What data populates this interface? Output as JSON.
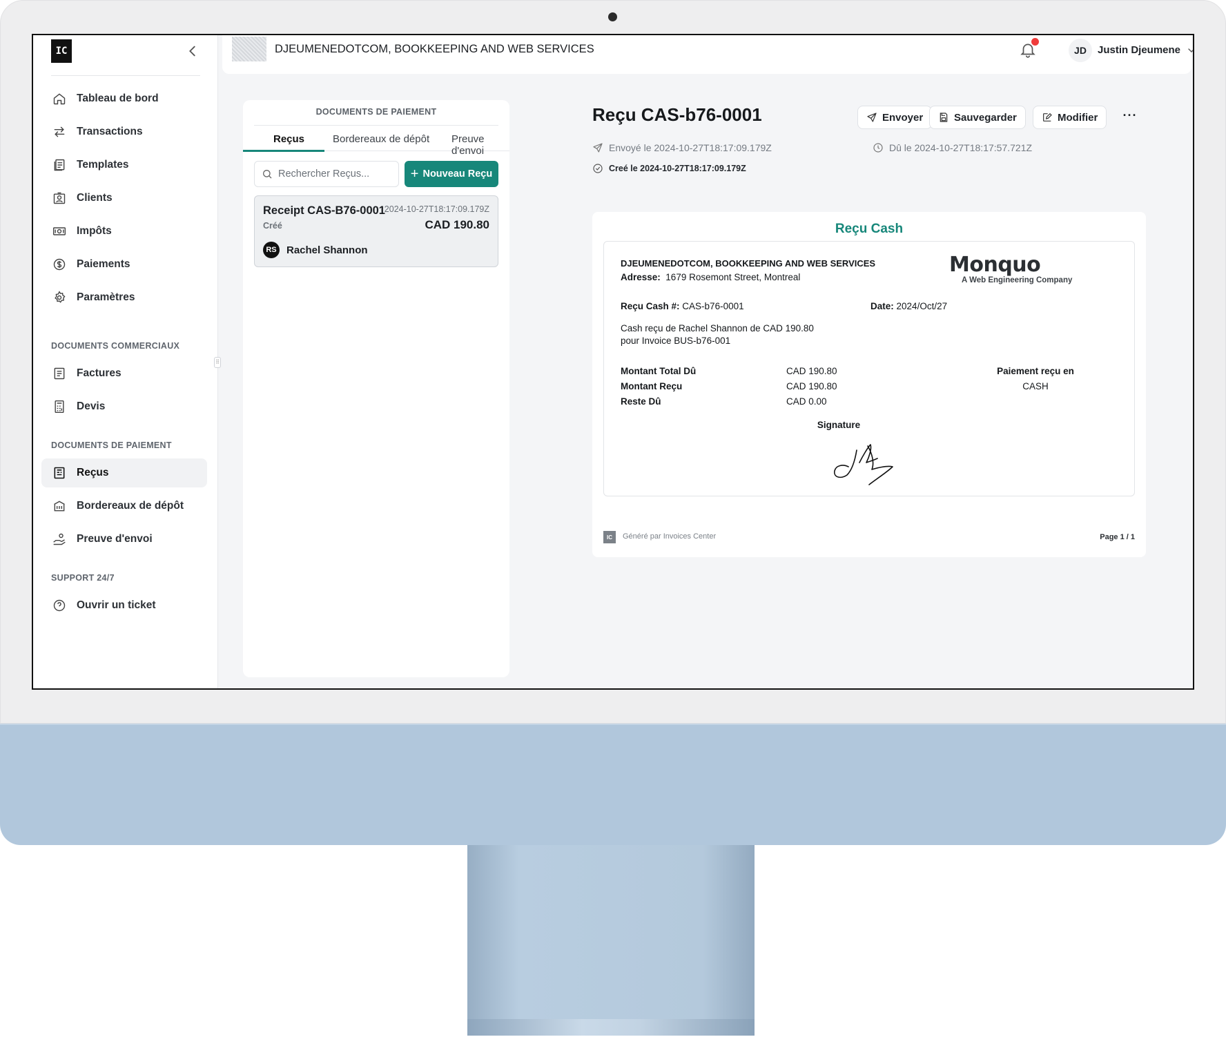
{
  "app": {
    "logo_text": "IC",
    "company_name": "DJEUMENEDOTCOM, BOOKKEEPING AND WEB SERVICES",
    "user_initials": "JD",
    "user_name": "Justin Djeumene"
  },
  "sidebar": {
    "main_items": [
      {
        "label": "Tableau de bord",
        "icon": "home-icon"
      },
      {
        "label": "Transactions",
        "icon": "arrows-swap-icon"
      },
      {
        "label": "Templates",
        "icon": "templates-icon"
      },
      {
        "label": "Clients",
        "icon": "clients-icon"
      },
      {
        "label": "Impôts",
        "icon": "tax-icon"
      },
      {
        "label": "Paiements",
        "icon": "dollar-icon"
      },
      {
        "label": "Paramètres",
        "icon": "gear-icon"
      }
    ],
    "section_commercial": "DOCUMENTS COMMERCIAUX",
    "commercial_items": [
      {
        "label": "Factures",
        "icon": "invoice-icon"
      },
      {
        "label": "Devis",
        "icon": "calculator-icon"
      }
    ],
    "section_payment": "DOCUMENTS DE PAIEMENT",
    "payment_items": [
      {
        "label": "Reçus",
        "icon": "receipt-icon",
        "active": true
      },
      {
        "label": "Bordereaux de dépôt",
        "icon": "bank-icon"
      },
      {
        "label": "Preuve d'envoi",
        "icon": "hand-money-icon"
      }
    ],
    "section_support": "SUPPORT 24/7",
    "support_items": [
      {
        "label": "Ouvrir un ticket",
        "icon": "help-circle-icon"
      }
    ]
  },
  "list_panel": {
    "header": "DOCUMENTS DE PAIEMENT",
    "tabs": [
      "Reçus",
      "Bordereaux de dépôt",
      "Preuve d'envoi"
    ],
    "active_tab": 0,
    "search_placeholder": "Rechercher Reçus...",
    "new_button": "Nouveau Reçu",
    "receipts": [
      {
        "title": "Receipt CAS-B76-0001",
        "date": "2024-10-27T18:17:09.179Z",
        "status": "Créé",
        "amount": "CAD 190.80",
        "client_initials": "RS",
        "client": "Rachel Shannon"
      }
    ]
  },
  "detail": {
    "title": "Reçu CAS-b76-0001",
    "actions": {
      "send": "Envoyer",
      "save": "Sauvegarder",
      "edit": "Modifier",
      "more": "···"
    },
    "sent": "Envoyé le 2024-10-27T18:17:09.179Z",
    "due": "Dû le 2024-10-27T18:17:57.721Z",
    "created": "Creé le 2024-10-27T18:17:09.179Z"
  },
  "document": {
    "heading": "Reçu Cash",
    "company": "DJEUMENEDOTCOM, BOOKKEEPING AND WEB SERVICES",
    "address_label": "Adresse:",
    "address": "1679 Rosemont Street, Montreal",
    "brand": "Monquo",
    "brand_tagline": "A Web Engineering Company",
    "receipt_no_label": "Reçu Cash #:",
    "receipt_no": "CAS-b76-0001",
    "date_label": "Date:",
    "date": "2024/Oct/27",
    "description_line1": "Cash reçu de Rachel Shannon de CAD 190.80",
    "description_line2": "pour Invoice BUS-b76-001",
    "totals": [
      {
        "label": "Montant Total Dû",
        "value": "CAD 190.80"
      },
      {
        "label": "Montant Reçu",
        "value": "CAD 190.80"
      },
      {
        "label": "Reste Dû",
        "value": "CAD 0.00"
      }
    ],
    "payment_method_label": "Paiement reçu en",
    "payment_method": "CASH",
    "signature_label": "Signature",
    "footer_logo": "IC",
    "footer": "Généré par Invoices Center",
    "page": "Page 1 / 1"
  }
}
